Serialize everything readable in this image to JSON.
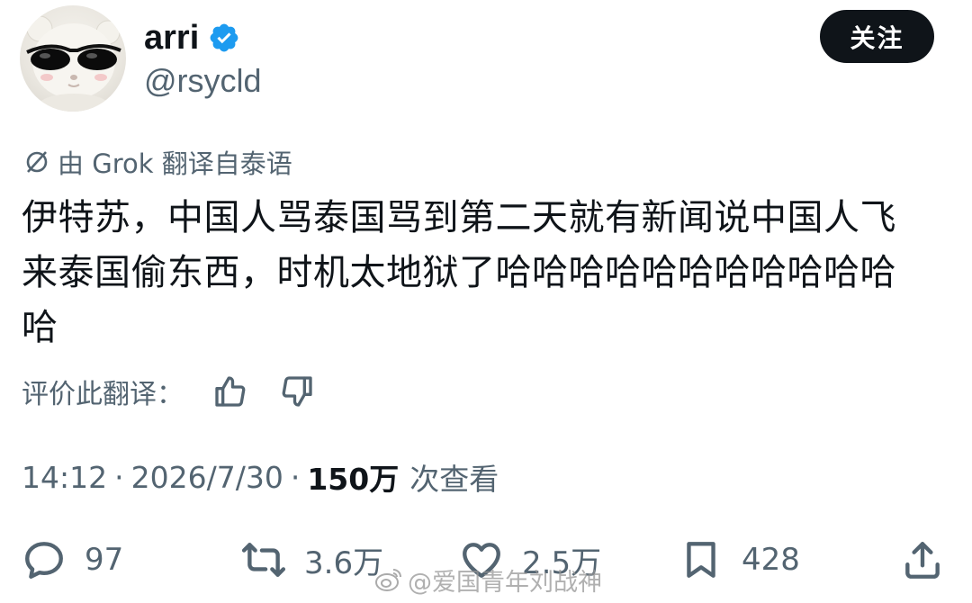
{
  "author": {
    "display_name": "arri",
    "handle": "@rsycld",
    "verified_icon": "verified-badge-icon",
    "avatar_icon": "avatar-sunglasses-icon"
  },
  "follow_button": {
    "label": "关注"
  },
  "translation": {
    "icon": "globe-icon",
    "notice": "由 Grok 翻译自泰语"
  },
  "tweet": {
    "text": "伊特苏，中国人骂泰国骂到第二天就有新闻说中国人飞来泰国偷东西，时机太地狱了哈哈哈哈哈哈哈哈哈哈哈哈"
  },
  "rate_translation": {
    "label": "评价此翻译：",
    "thumbs_up_icon": "thumbs-up-icon",
    "thumbs_down_icon": "thumbs-down-icon"
  },
  "meta": {
    "time": "14:12",
    "separator": "·",
    "date": "2026/7/30",
    "views_count": "150万",
    "views_label": "次查看"
  },
  "actions": {
    "reply": {
      "icon": "reply-icon",
      "count": "97"
    },
    "retweet": {
      "icon": "retweet-icon",
      "count": "3.6万"
    },
    "like": {
      "icon": "heart-icon",
      "count": "2.5万"
    },
    "bookmark": {
      "icon": "bookmark-icon",
      "count": "428"
    },
    "share": {
      "icon": "share-icon"
    }
  },
  "watermark": {
    "icon": "weibo-icon",
    "text": "@爱国青年刘战神"
  },
  "colors": {
    "text_primary": "#0f1419",
    "text_secondary": "#536471",
    "verified_blue": "#1d9bf0",
    "button_bg": "#0f1419"
  }
}
